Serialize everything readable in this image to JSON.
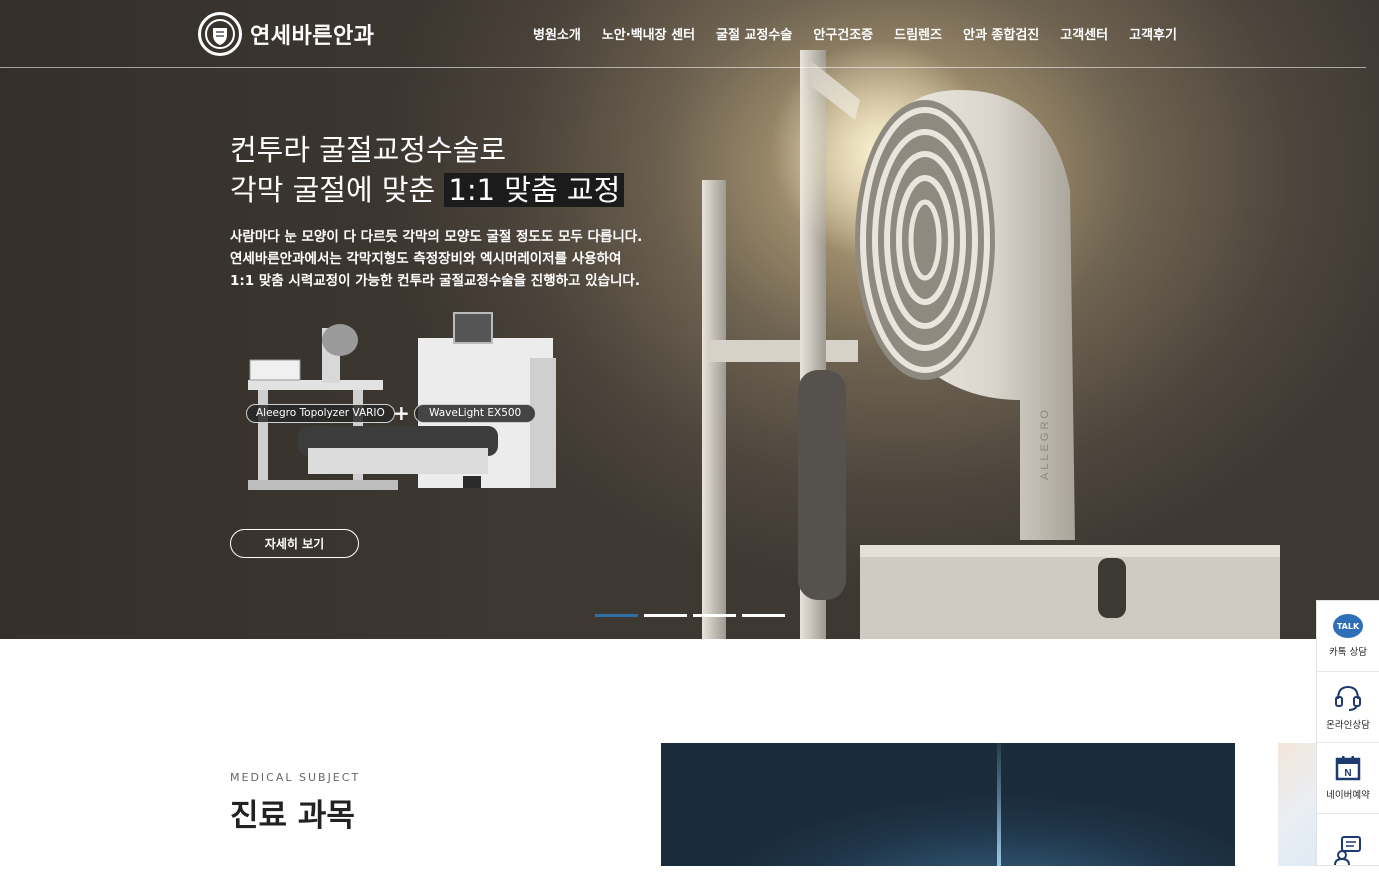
{
  "header": {
    "logo_text": "연세바른안과",
    "nav": [
      "병원소개",
      "노안·백내장 센터",
      "굴절 교정수술",
      "안구건조증",
      "드림렌즈",
      "안과 종합검진",
      "고객센터",
      "고객후기"
    ]
  },
  "hero": {
    "title_line1": "컨투라 굴절교정수술로",
    "title_line2_prefix": "각막 굴절에 맞춘 ",
    "title_line2_highlight": "1:1 맞춤 교정",
    "desc_line1": "사람마다 눈 모양이 다 다르듯 각막의 모양도 굴절 정도도 모두 다릅니다.",
    "desc_line2": "연세바른안과에서는 각막지형도 측정장비와 엑시머레이저를 사용하여",
    "desc_line3": "1:1 맞춤 시력교정이 가능한 컨투라 굴절교정수술을 진행하고 있습니다.",
    "equip_label_1": "Aleegro Topolyzer VARIO",
    "equip_label_2": "WaveLight EX500",
    "plus_sign": "+",
    "device_brand": "ALLEGRO",
    "detail_button": "자세히 보기",
    "slides_total": 4,
    "slide_active": 1
  },
  "section": {
    "subtitle": "MEDICAL SUBJECT",
    "title": "진료 과목"
  },
  "quick_menu": [
    {
      "icon": "kakao-talk-icon",
      "icon_text": "TALK",
      "label": "카톡 상담"
    },
    {
      "icon": "headset-icon",
      "label": "온라인상담"
    },
    {
      "icon": "naver-calendar-icon",
      "icon_text": "N",
      "label": "네이버예약"
    },
    {
      "icon": "chat-person-icon",
      "label": ""
    }
  ],
  "colors": {
    "accent_blue": "#2e6fa6",
    "naver_navy": "#1e3a6e",
    "kakao_blue": "#2f6fb7"
  }
}
